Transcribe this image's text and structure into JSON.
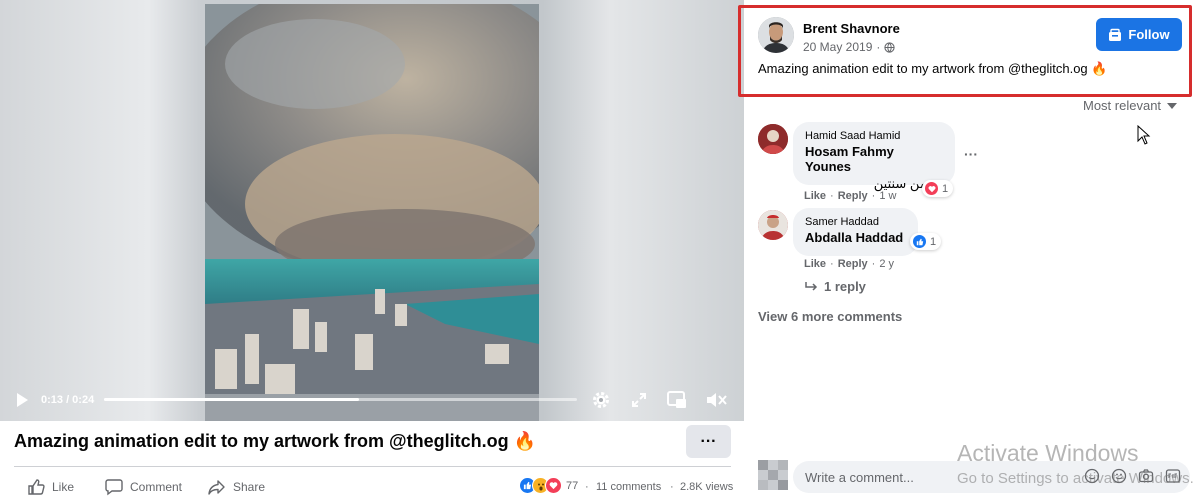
{
  "player": {
    "time": "0:13 / 0:24",
    "progress": 0.54
  },
  "caption": {
    "title": "Amazing animation edit to my artwork from @theglitch.og 🔥",
    "more": "···"
  },
  "actions": {
    "like": "Like",
    "comment": "Comment",
    "share": "Share"
  },
  "stats": {
    "reaction_count": "77",
    "comments": "11 comments",
    "views": "2.8K views",
    "separator": "·"
  },
  "post": {
    "author": "Brent Shavnore",
    "date": "20 May 2019",
    "meta_sep": "·",
    "follow_label": "Follow",
    "text": "Amazing animation edit to my artwork from @theglitch.og 🔥"
  },
  "sort": {
    "label": "Most relevant"
  },
  "comments": [
    {
      "author": "Hamid Saad Hamid",
      "mention": "Hosam Fahmy Younes",
      "body": "ده من سنتين",
      "reaction_count": "1",
      "like": "Like",
      "reply": "Reply",
      "time": "1 w",
      "sep": "·",
      "more": "···"
    },
    {
      "author": "Samer Haddad",
      "mention": "Abdalla Haddad",
      "reaction_count": "1",
      "like": "Like",
      "reply": "Reply",
      "time": "2 y",
      "sep": "·"
    }
  ],
  "reply_toggle": "1 reply",
  "view_more": "View 6 more comments",
  "composer": {
    "placeholder": "Write a comment..."
  },
  "watermark": {
    "title": "Activate Windows",
    "subtitle": "Go to Settings to activate Windows."
  },
  "colors": {
    "accent": "#1b74e4",
    "highlight_border": "#d62d2d",
    "secondary_text": "#65676b"
  },
  "icons": [
    "play-icon",
    "settings-icon",
    "fullscreen-icon",
    "pip-icon",
    "volume-icon",
    "globe-icon",
    "follow-icon",
    "chevron-down-icon",
    "reply-arrow-icon",
    "like-icon",
    "comment-icon",
    "share-icon",
    "emoji-icon",
    "camera-icon",
    "gif-icon",
    "sticker-icon"
  ]
}
